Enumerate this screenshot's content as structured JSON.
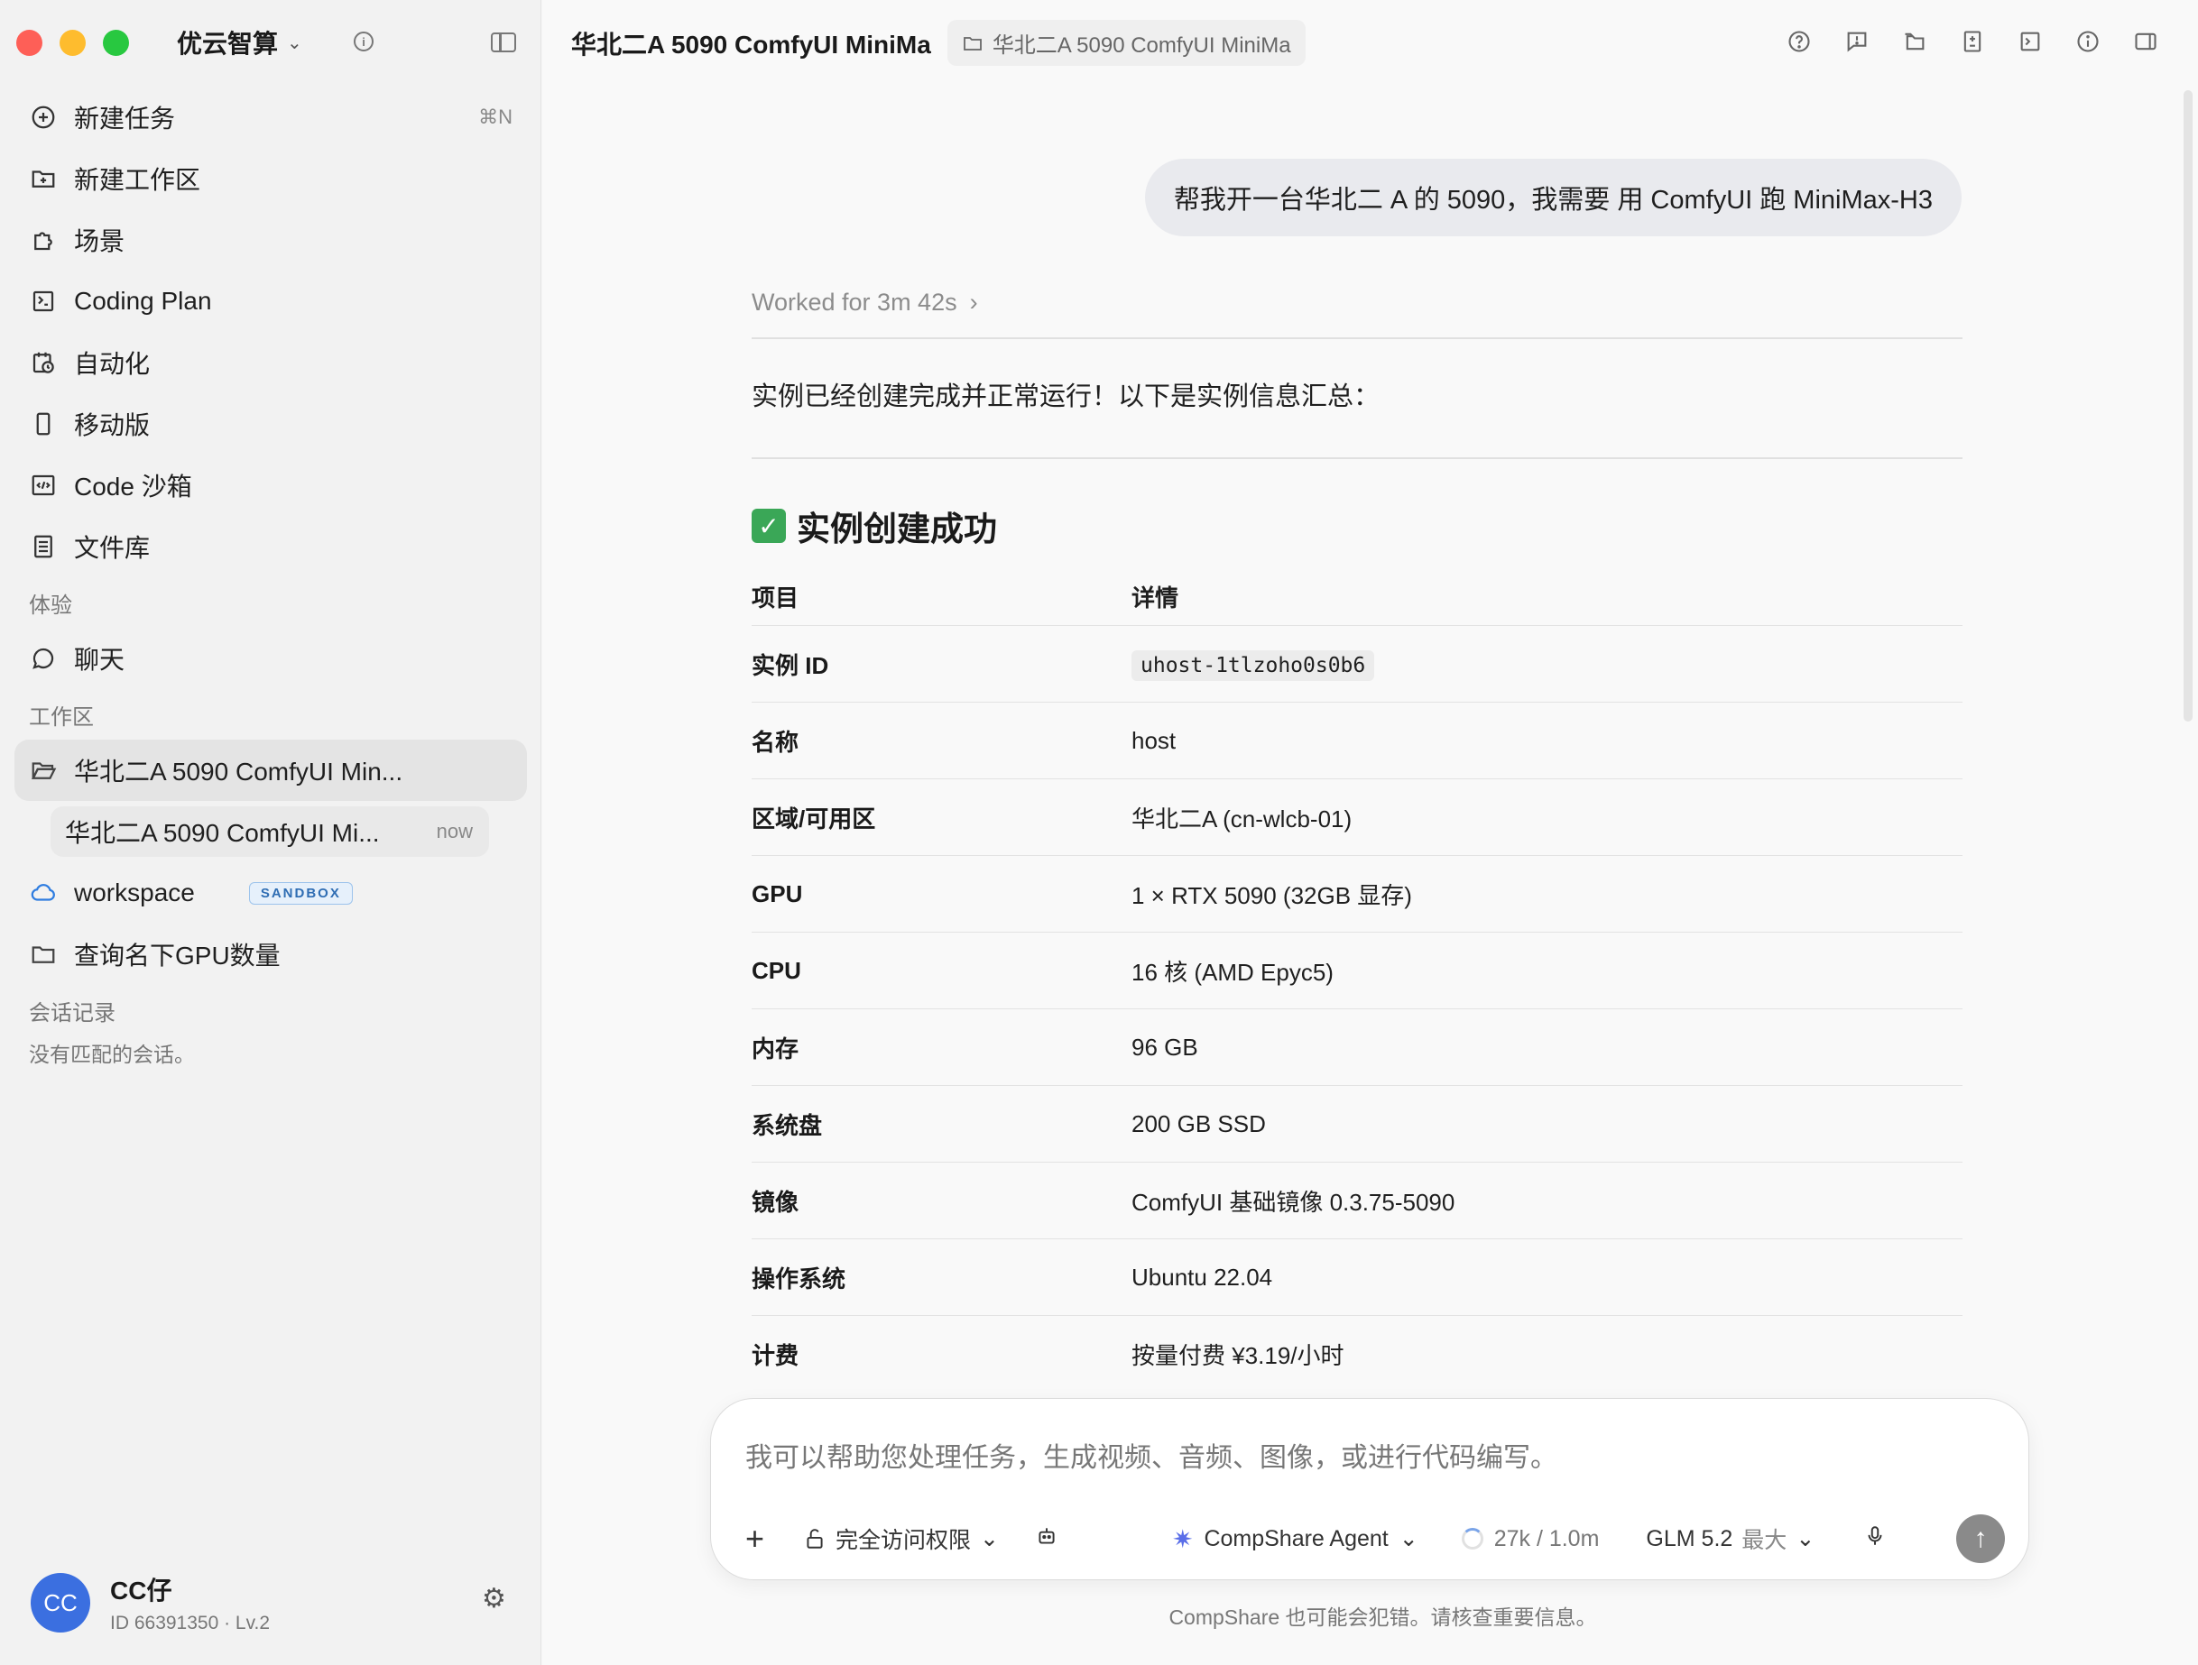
{
  "app": {
    "name": "优云智算"
  },
  "sidebar": {
    "nav": [
      {
        "label": "新建任务",
        "shortcut": "⌘N"
      },
      {
        "label": "新建工作区"
      },
      {
        "label": "场景"
      },
      {
        "label": "Coding Plan"
      },
      {
        "label": "自动化"
      },
      {
        "label": "移动版"
      },
      {
        "label": "Code 沙箱"
      },
      {
        "label": "文件库"
      }
    ],
    "experience_label": "体验",
    "chat_label": "聊天",
    "workspace_label": "工作区",
    "workspaces": [
      {
        "label": "华北二A 5090 ComfyUI Min..."
      },
      {
        "label": "华北二A 5090 ComfyUI Mi...",
        "time": "now"
      },
      {
        "label": "workspace",
        "badge": "SANDBOX"
      },
      {
        "label": "查询名下GPU数量"
      }
    ],
    "history_label": "会话记录",
    "history_empty": "没有匹配的会话。",
    "user": {
      "initials": "CC",
      "name": "CC仔",
      "meta": "ID 66391350 · Lv.2"
    }
  },
  "main": {
    "title": "华北二A 5090 ComfyUI MiniMa",
    "breadcrumb": "华北二A 5090 ComfyUI MiniMa",
    "user_message": "帮我开一台华北二 A 的 5090，我需要 用 ComfyUI 跑 MiniMax-H3",
    "worked": "Worked for 3m 42s",
    "intro": "实例已经创建完成并正常运行！以下是实例信息汇总：",
    "heading": "实例创建成功",
    "table": {
      "headers": [
        "项目",
        "详情"
      ],
      "rows": [
        [
          "实例 ID",
          "uhost-1tlzoho0s0b6"
        ],
        [
          "名称",
          "host"
        ],
        [
          "区域/可用区",
          "华北二A (cn-wlcb-01)"
        ],
        [
          "GPU",
          "1 × RTX 5090 (32GB 显存)"
        ],
        [
          "CPU",
          "16 核 (AMD Epyc5)"
        ],
        [
          "内存",
          "96 GB"
        ],
        [
          "系统盘",
          "200 GB SSD"
        ],
        [
          "镜像",
          "ComfyUI 基础镜像 0.3.75-5090"
        ],
        [
          "操作系统",
          "Ubuntu 22.04"
        ],
        [
          "计费",
          "按量付费 ¥3.19/小时"
        ]
      ]
    }
  },
  "composer": {
    "placeholder": "我可以帮助您处理任务，生成视频、音频、图像，或进行代码编写。",
    "permission": "完全访问权限",
    "agent": "CompShare Agent",
    "tokens": "27k / 1.0m",
    "model": "GLM 5.2",
    "model_level": "最大",
    "disclaimer": "CompShare 也可能会犯错。请核查重要信息。"
  },
  "colors": {
    "accent": "#3b6fe0",
    "success": "#3aa757",
    "badge": "#2f6db3"
  }
}
